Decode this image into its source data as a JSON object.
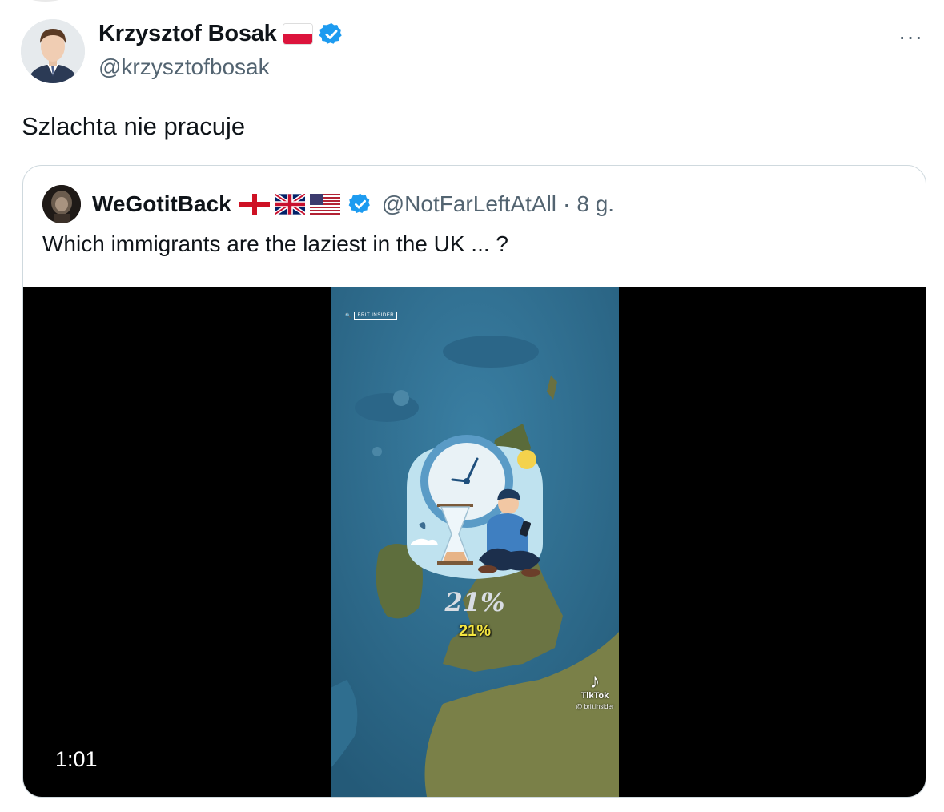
{
  "tweet": {
    "display_name": "Krzysztof Bosak",
    "handle": "@krzysztofbosak",
    "text": "Szlachta nie pracuje",
    "more_label": "···"
  },
  "quote": {
    "display_name": "WeGotitBack",
    "handle": "@NotFarLeftAtAll",
    "separator": "·",
    "time": "8 g.",
    "text": "Which immigrants are the laziest in the UK ... ?"
  },
  "video": {
    "duration": "1:01",
    "stat_big": "21%",
    "stat_small": "21%",
    "brand": "BRIT INSIDER",
    "tiktok_label": "TikTok",
    "tiktok_handle": "@ brit.insider"
  },
  "colors": {
    "verified_blue": "#1d9bf0",
    "secondary_text": "#536471",
    "border": "#cfd9de",
    "ocean": "#2f6e8f",
    "land": "#5e6e3d"
  }
}
